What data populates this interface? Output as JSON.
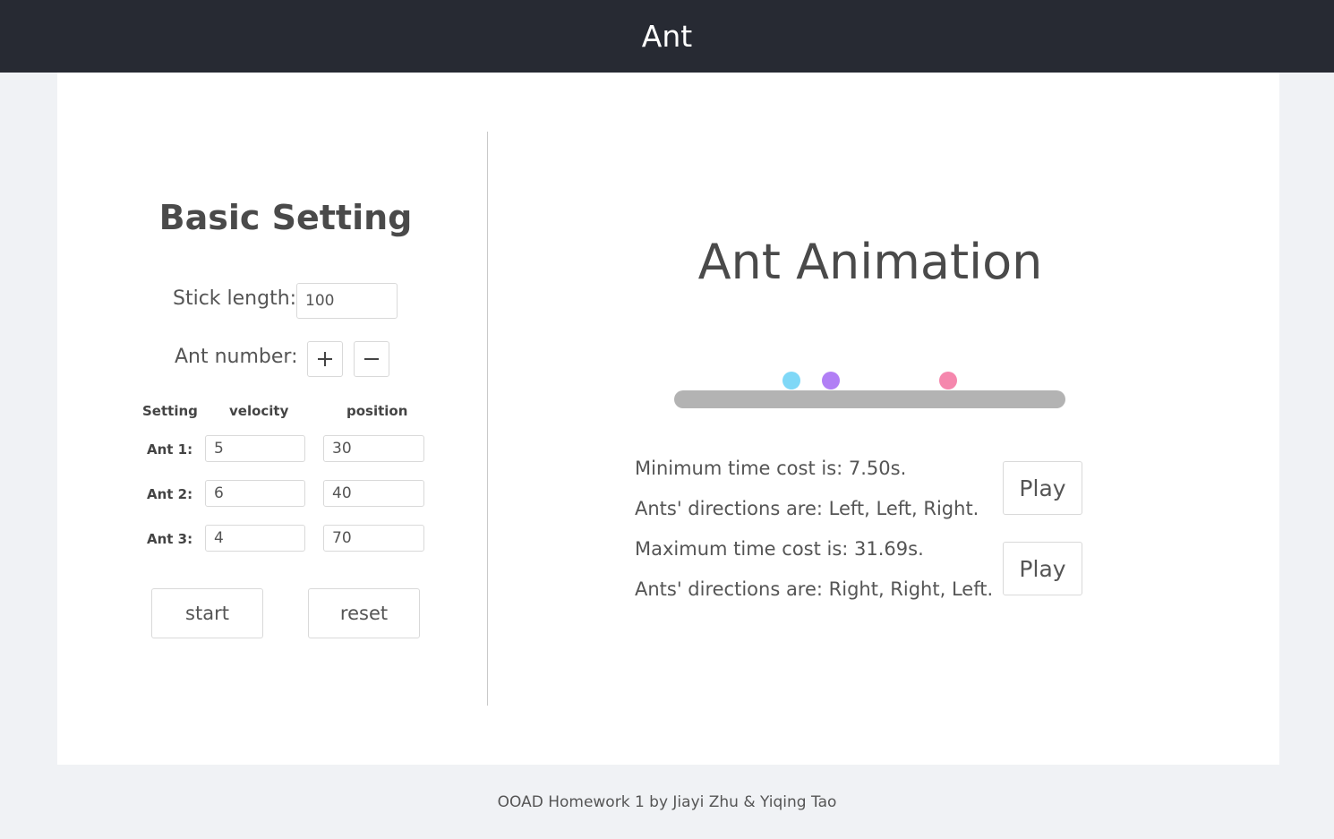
{
  "header": {
    "title": "Ant"
  },
  "settings": {
    "title": "Basic Setting",
    "stick_length_label": "Stick length:",
    "stick_length_value": "100",
    "ant_number_label": "Ant number:",
    "plus_icon": "plus-icon",
    "minus_icon": "minus-icon",
    "columns": [
      "Setting",
      "velocity",
      "position"
    ],
    "ants": [
      {
        "label": "Ant 1:",
        "velocity": "5",
        "position": "30"
      },
      {
        "label": "Ant 2:",
        "velocity": "6",
        "position": "40"
      },
      {
        "label": "Ant 3:",
        "velocity": "4",
        "position": "70"
      }
    ],
    "start_label": "start",
    "reset_label": "reset"
  },
  "animation": {
    "title": "Ant Animation",
    "stick_color": "#b3b3b3",
    "ants": [
      {
        "color": "#7fd8f7",
        "position": 30
      },
      {
        "color": "#b17ff5",
        "position": 40
      },
      {
        "color": "#f587ad",
        "position": 70
      }
    ],
    "results": [
      {
        "time_text": "Minimum time cost is: 7.50s.",
        "directions_text": "Ants' directions are: Left, Left, Right.",
        "play_label": "Play"
      },
      {
        "time_text": "Maximum time cost is: 31.69s.",
        "directions_text": "Ants' directions are: Right, Right, Left.",
        "play_label": "Play"
      }
    ]
  },
  "footer": {
    "text": "OOAD Homework 1 by Jiayi Zhu & Yiqing Tao"
  }
}
